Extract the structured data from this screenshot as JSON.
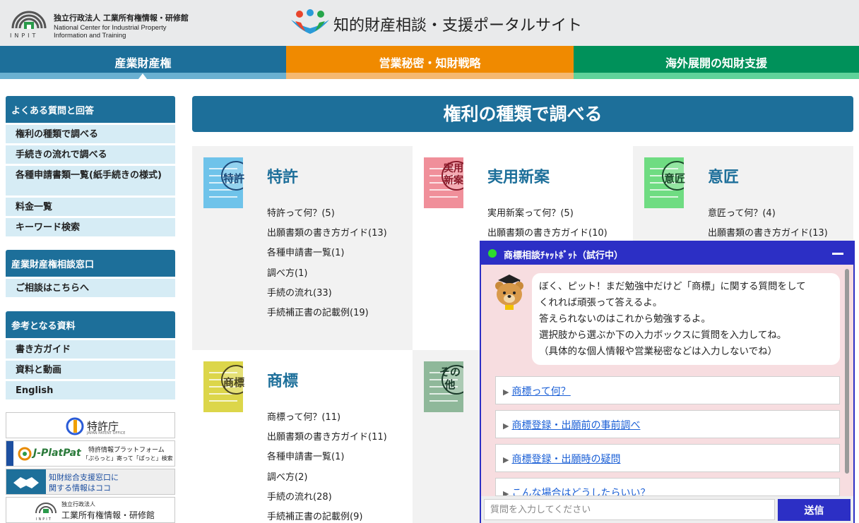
{
  "header": {
    "org_jp": "独立行政法人 工業所有権情報・研修館",
    "org_en_line1": "National Center for Industrial Property",
    "org_en_line2": "Information and Training",
    "org_abbr": "INPIT",
    "portal_title": "知的財産相談・支援ポータルサイト"
  },
  "nav": {
    "tabs": [
      {
        "label": "産業財産権",
        "active": true,
        "color": "#1d6f9a"
      },
      {
        "label": "営業秘密・知財戦略",
        "active": false,
        "color": "#f08a00"
      },
      {
        "label": "海外展開の知財支援",
        "active": false,
        "color": "#00915a"
      }
    ]
  },
  "sidebar": {
    "faq": {
      "heading": "よくある質問と回答",
      "items": [
        "権利の種類で調べる",
        "手続きの流れで調べる",
        "各種申請書類一覧(紙手続きの様式)",
        "料金一覧",
        "キーワード検索"
      ]
    },
    "consult": {
      "heading": "産業財産権相談窓口",
      "items": [
        "ご相談はこちらへ"
      ]
    },
    "reference": {
      "heading": "参考となる資料",
      "items": [
        "書き方ガイド",
        "資料と動画",
        "English"
      ]
    },
    "banners": {
      "jpo": "特許庁",
      "jpo_en": "JAPAN PATENT OFFICE",
      "jplatpat": "J-PlatPat",
      "jplatpat_desc1": "特許情報プラットフォーム",
      "jplatpat_desc2": "「ぷらっと」寄って「ぱっと」検索",
      "support1": "知財総合支援窓口に",
      "support2": "関する情報はココ",
      "inpit_jp_small": "独立行政法人",
      "inpit_jp": "工業所有権情報・研修館",
      "inpit_abbr": "INPIT"
    }
  },
  "main": {
    "title": "権利の種類で調べる",
    "cards": [
      {
        "title": "特許",
        "badge": "特許",
        "color": "#6fc3ea",
        "links": [
          "特許って何？(5)",
          "出願書類の書き方ガイド(13)",
          "各種申請書一覧(1)",
          "調べ方(1)",
          "手続の流れ(33)",
          "手続補正書の記載例(19)"
        ]
      },
      {
        "title": "実用新案",
        "badge": "実用新案",
        "badge_line1": "実用",
        "badge_line2": "新案",
        "color": "#f08f9a",
        "links": [
          "実用新案って何？(5)",
          "出願書類の書き方ガイド(10)"
        ]
      },
      {
        "title": "意匠",
        "badge": "意匠",
        "color": "#6fdc82",
        "links": [
          "意匠って何？(4)",
          "出願書類の書き方ガイド(13)"
        ]
      },
      {
        "title": "商標",
        "badge": "商標",
        "color": "#dcd64a",
        "links": [
          "商標って何？(11)",
          "出願書類の書き方ガイド(11)",
          "各種申請書一覧(1)",
          "調べ方(2)",
          "手続の流れ(28)",
          "手続補正書の記載例(9)"
        ]
      },
      {
        "title": "",
        "badge": "その他",
        "badge_line1": "その",
        "badge_line2": "他",
        "color": "#8fb89a",
        "links": []
      }
    ]
  },
  "chat": {
    "title": "商標相談ﾁｬｯﾄﾎﾞｯﾄ（試行中）",
    "status": "online",
    "message_lines": [
      "ぼく、ピット！まだ勉強中だけど「商標」に関する質問をして",
      "くれれば頑張って答えるよ。",
      "答えられないのはこれから勉強するよ。",
      "選択肢から選ぶか下の入力ボックスに質問を入力してね。",
      "（具体的な個人情報や営業秘密などは入力しないでね）"
    ],
    "options": [
      "商標って何？",
      "商標登録・出願前の事前調べ",
      "商標登録・出願時の疑問",
      "こんな場合はどうしたらいい？"
    ],
    "input_placeholder": "質問を入力してください",
    "send_label": "送信"
  }
}
